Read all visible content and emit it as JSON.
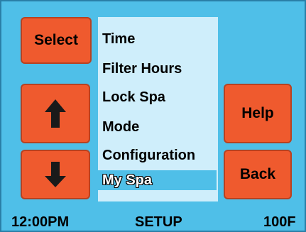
{
  "buttons": {
    "select_label": "Select",
    "help_label": "Help",
    "back_label": "Back",
    "up_icon": "arrow-up-icon",
    "down_icon": "arrow-down-icon"
  },
  "menu": {
    "items": [
      {
        "label": "Time",
        "selected": false
      },
      {
        "label": "Filter Hours",
        "selected": false
      },
      {
        "label": "Lock Spa",
        "selected": false
      },
      {
        "label": "Mode",
        "selected": false
      },
      {
        "label": "Configuration",
        "selected": false
      },
      {
        "label": "My Spa",
        "selected": true
      }
    ]
  },
  "status_bar": {
    "time": "12:00PM",
    "mode": "SETUP",
    "temperature": "100F"
  },
  "colors": {
    "background": "#4fbfe8",
    "button": "#ef5a2e",
    "menu_background": "#cfeefb",
    "selected_row": "#4fbfe8"
  }
}
